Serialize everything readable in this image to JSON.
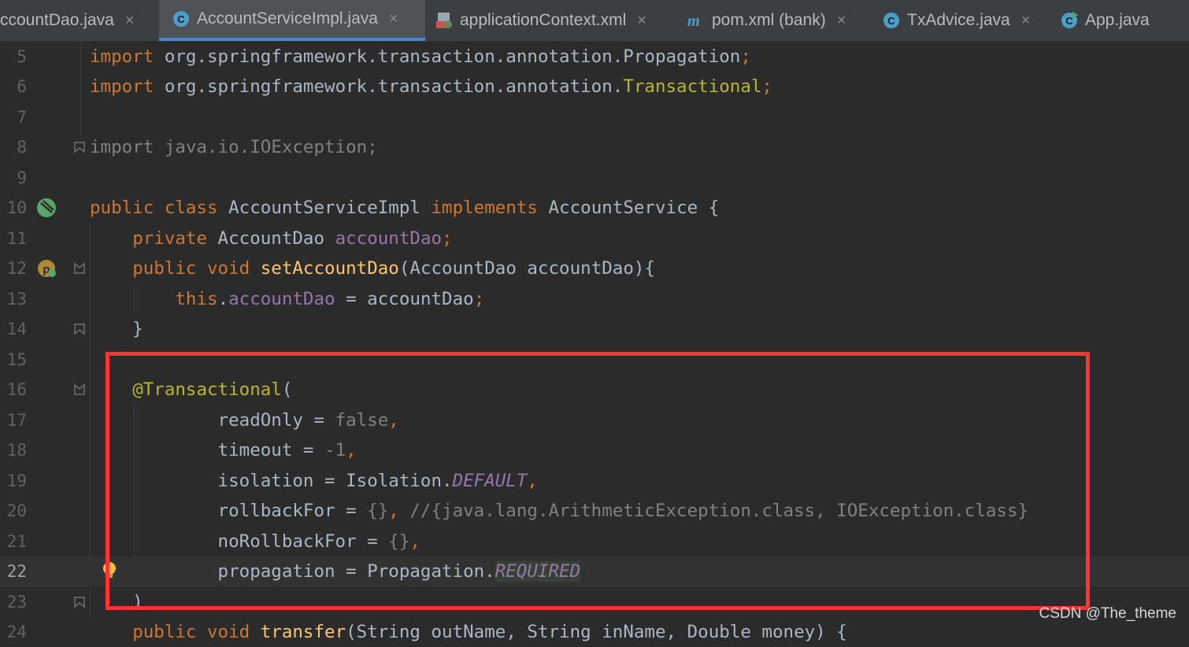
{
  "tabs": [
    {
      "label": "AccountDao.java",
      "icon": "java-class-icon"
    },
    {
      "label": "AccountServiceImpl.java",
      "icon": "java-class-icon",
      "active": true
    },
    {
      "label": "applicationContext.xml",
      "icon": "spring-xml-icon"
    },
    {
      "label": "pom.xml (bank)",
      "icon": "maven-icon"
    },
    {
      "label": "TxAdvice.java",
      "icon": "java-class-icon"
    },
    {
      "label": "App.java",
      "icon": "java-run-class-icon"
    }
  ],
  "tab_close_glyph": "×",
  "editor": {
    "current_line": 22,
    "lines": [
      {
        "n": "5",
        "text": "import org.springframework.transaction.annotation.Propagation;"
      },
      {
        "n": "6",
        "text": "import org.springframework.transaction.annotation.Transactional;"
      },
      {
        "n": "7",
        "text": ""
      },
      {
        "n": "8",
        "text": "import java.io.IOException;"
      },
      {
        "n": "9",
        "text": ""
      },
      {
        "n": "10",
        "text": "public class AccountServiceImpl implements AccountService {"
      },
      {
        "n": "11",
        "text": "    private AccountDao accountDao;"
      },
      {
        "n": "12",
        "text": "    public void setAccountDao(AccountDao accountDao){"
      },
      {
        "n": "13",
        "text": "        this.accountDao = accountDao;"
      },
      {
        "n": "14",
        "text": "    }"
      },
      {
        "n": "15",
        "text": ""
      },
      {
        "n": "16",
        "text": "    @Transactional("
      },
      {
        "n": "17",
        "text": "            readOnly = false,"
      },
      {
        "n": "18",
        "text": "            timeout = -1,"
      },
      {
        "n": "19",
        "text": "            isolation = Isolation.DEFAULT,"
      },
      {
        "n": "20",
        "text": "            rollbackFor = {}, //{java.lang.ArithmeticException.class, IOException.class}"
      },
      {
        "n": "21",
        "text": "            noRollbackFor = {},"
      },
      {
        "n": "22",
        "text": "            propagation = Propagation.REQUIRED"
      },
      {
        "n": "23",
        "text": "    )"
      },
      {
        "n": "24",
        "text": "    public void transfer(String outName, String inName, Double money) {"
      }
    ]
  },
  "gutter_icons": {
    "line10": "spring-bean-icon",
    "line12": "spring-injection-icon",
    "line22": "lightbulb-icon"
  },
  "watermark": "CSDN @The_theme",
  "colors": {
    "keyword": "#cc7832",
    "annotation": "#bbb529",
    "field": "#9876aa",
    "method": "#ffc66d",
    "highlight_box": "#ff3333",
    "active_tab_underline": "#4a88c7"
  }
}
